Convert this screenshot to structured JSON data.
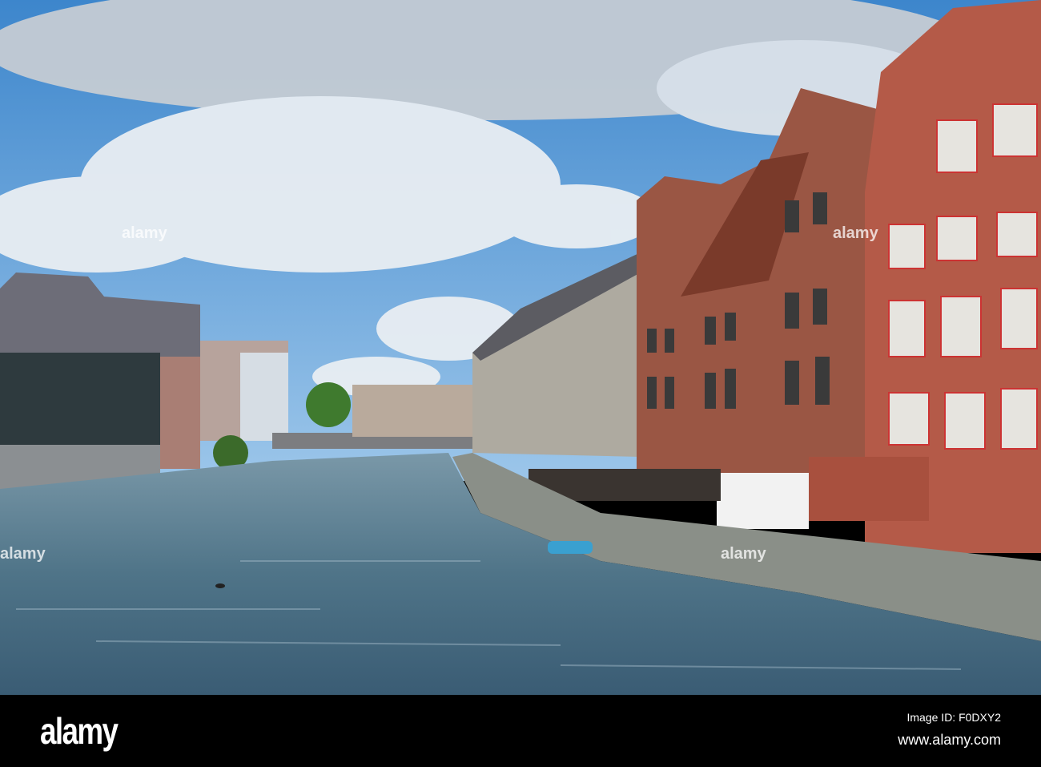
{
  "footer": {
    "logo": "alamy",
    "image_id": "Image ID: F0DXY2",
    "website": "www.alamy.com"
  },
  "watermark": {
    "text": "alamy"
  },
  "colors": {
    "sky": "#4a90d0",
    "water": "#4a7088",
    "brick": "#a05040"
  }
}
